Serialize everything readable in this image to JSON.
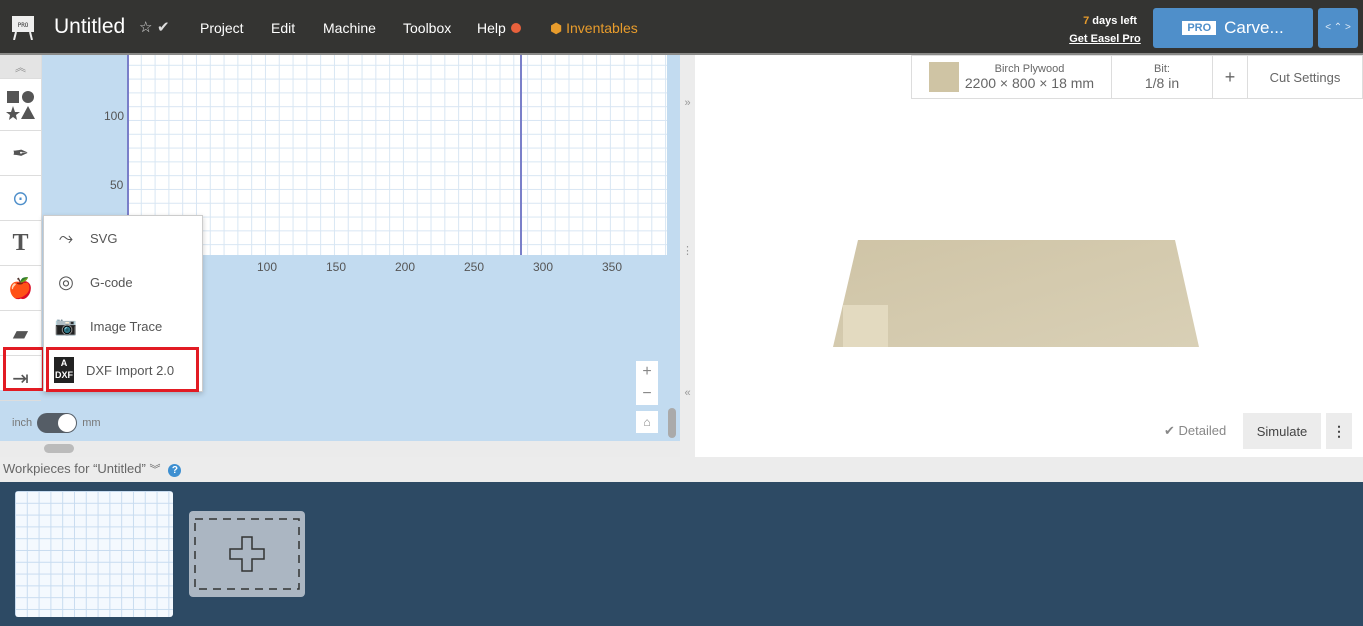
{
  "header": {
    "title": "Untitled",
    "menu": [
      "Project",
      "Edit",
      "Machine",
      "Toolbox",
      "Help"
    ],
    "brand": "Inventables",
    "days_num": "7",
    "days_text": " days left",
    "get_pro": "Get Easel Pro",
    "pro_badge": "PRO",
    "carve": "Carve...",
    "logo_text": "PRO"
  },
  "canvas": {
    "y_ticks": [
      "100",
      "50"
    ],
    "x_ticks": [
      "100",
      "150",
      "200",
      "250",
      "300",
      "350"
    ],
    "unit_left": "inch",
    "unit_right": "mm"
  },
  "import_menu": {
    "items": [
      "SVG",
      "G-code",
      "Image Trace",
      "DXF Import 2.0"
    ]
  },
  "material": {
    "name": "Birch Plywood",
    "dims": "2200 × 800 × 18 mm",
    "bit_label": "Bit:",
    "bit_value": "1/8 in",
    "add": "+",
    "cut_settings": "Cut Settings"
  },
  "preview": {
    "detailed": "Detailed",
    "simulate": "Simulate"
  },
  "workpieces": {
    "label": "Workpieces for “Untitled”"
  },
  "colors": {
    "accent": "#4f8fca",
    "brand": "#e89c2c",
    "highlight": "#e21b23",
    "canvas_bg": "#c2dbf0"
  }
}
